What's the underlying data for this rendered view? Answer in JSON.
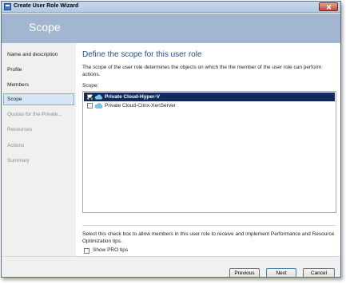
{
  "window": {
    "title": "Create User Role Wizard"
  },
  "header": {
    "title": "Scope"
  },
  "sidebar": {
    "items": [
      {
        "label": "Name and description",
        "state": "normal"
      },
      {
        "label": "Profile",
        "state": "normal"
      },
      {
        "label": "Members",
        "state": "normal"
      },
      {
        "label": "Scope",
        "state": "active"
      },
      {
        "label": "Quotas for the Private...",
        "state": "disabled"
      },
      {
        "label": "Resources",
        "state": "disabled"
      },
      {
        "label": "Actions",
        "state": "disabled"
      },
      {
        "label": "Summary",
        "state": "disabled"
      }
    ]
  },
  "main": {
    "heading": "Define the scope for this user role",
    "description": "The scope of the user role determines the objects on which the the member of the user role can perform actions.",
    "scope_label": "Scope:",
    "scope_items": [
      {
        "label": "Private Cloud-Hyper-V",
        "checked": true,
        "selected": true,
        "icon": "cloud-icon"
      },
      {
        "label": "Private Cloud-Citrix-XenServer",
        "checked": false,
        "selected": false,
        "icon": "cloud-icon"
      }
    ],
    "pro_note": "Select this check box to allow members in this user role to receive and implement Performance and Resource Optimization tips.",
    "pro_checkbox_label": "Show PRO tips",
    "pro_checked": false
  },
  "footer": {
    "previous_label": "Previous",
    "next_label": "Next",
    "cancel_label": "Cancel"
  },
  "colors": {
    "header_bg": "#a2b6cf",
    "heading": "#1f4e8a",
    "selection_bg": "#112a5c",
    "active_nav_bg": "#d7e6f7"
  }
}
